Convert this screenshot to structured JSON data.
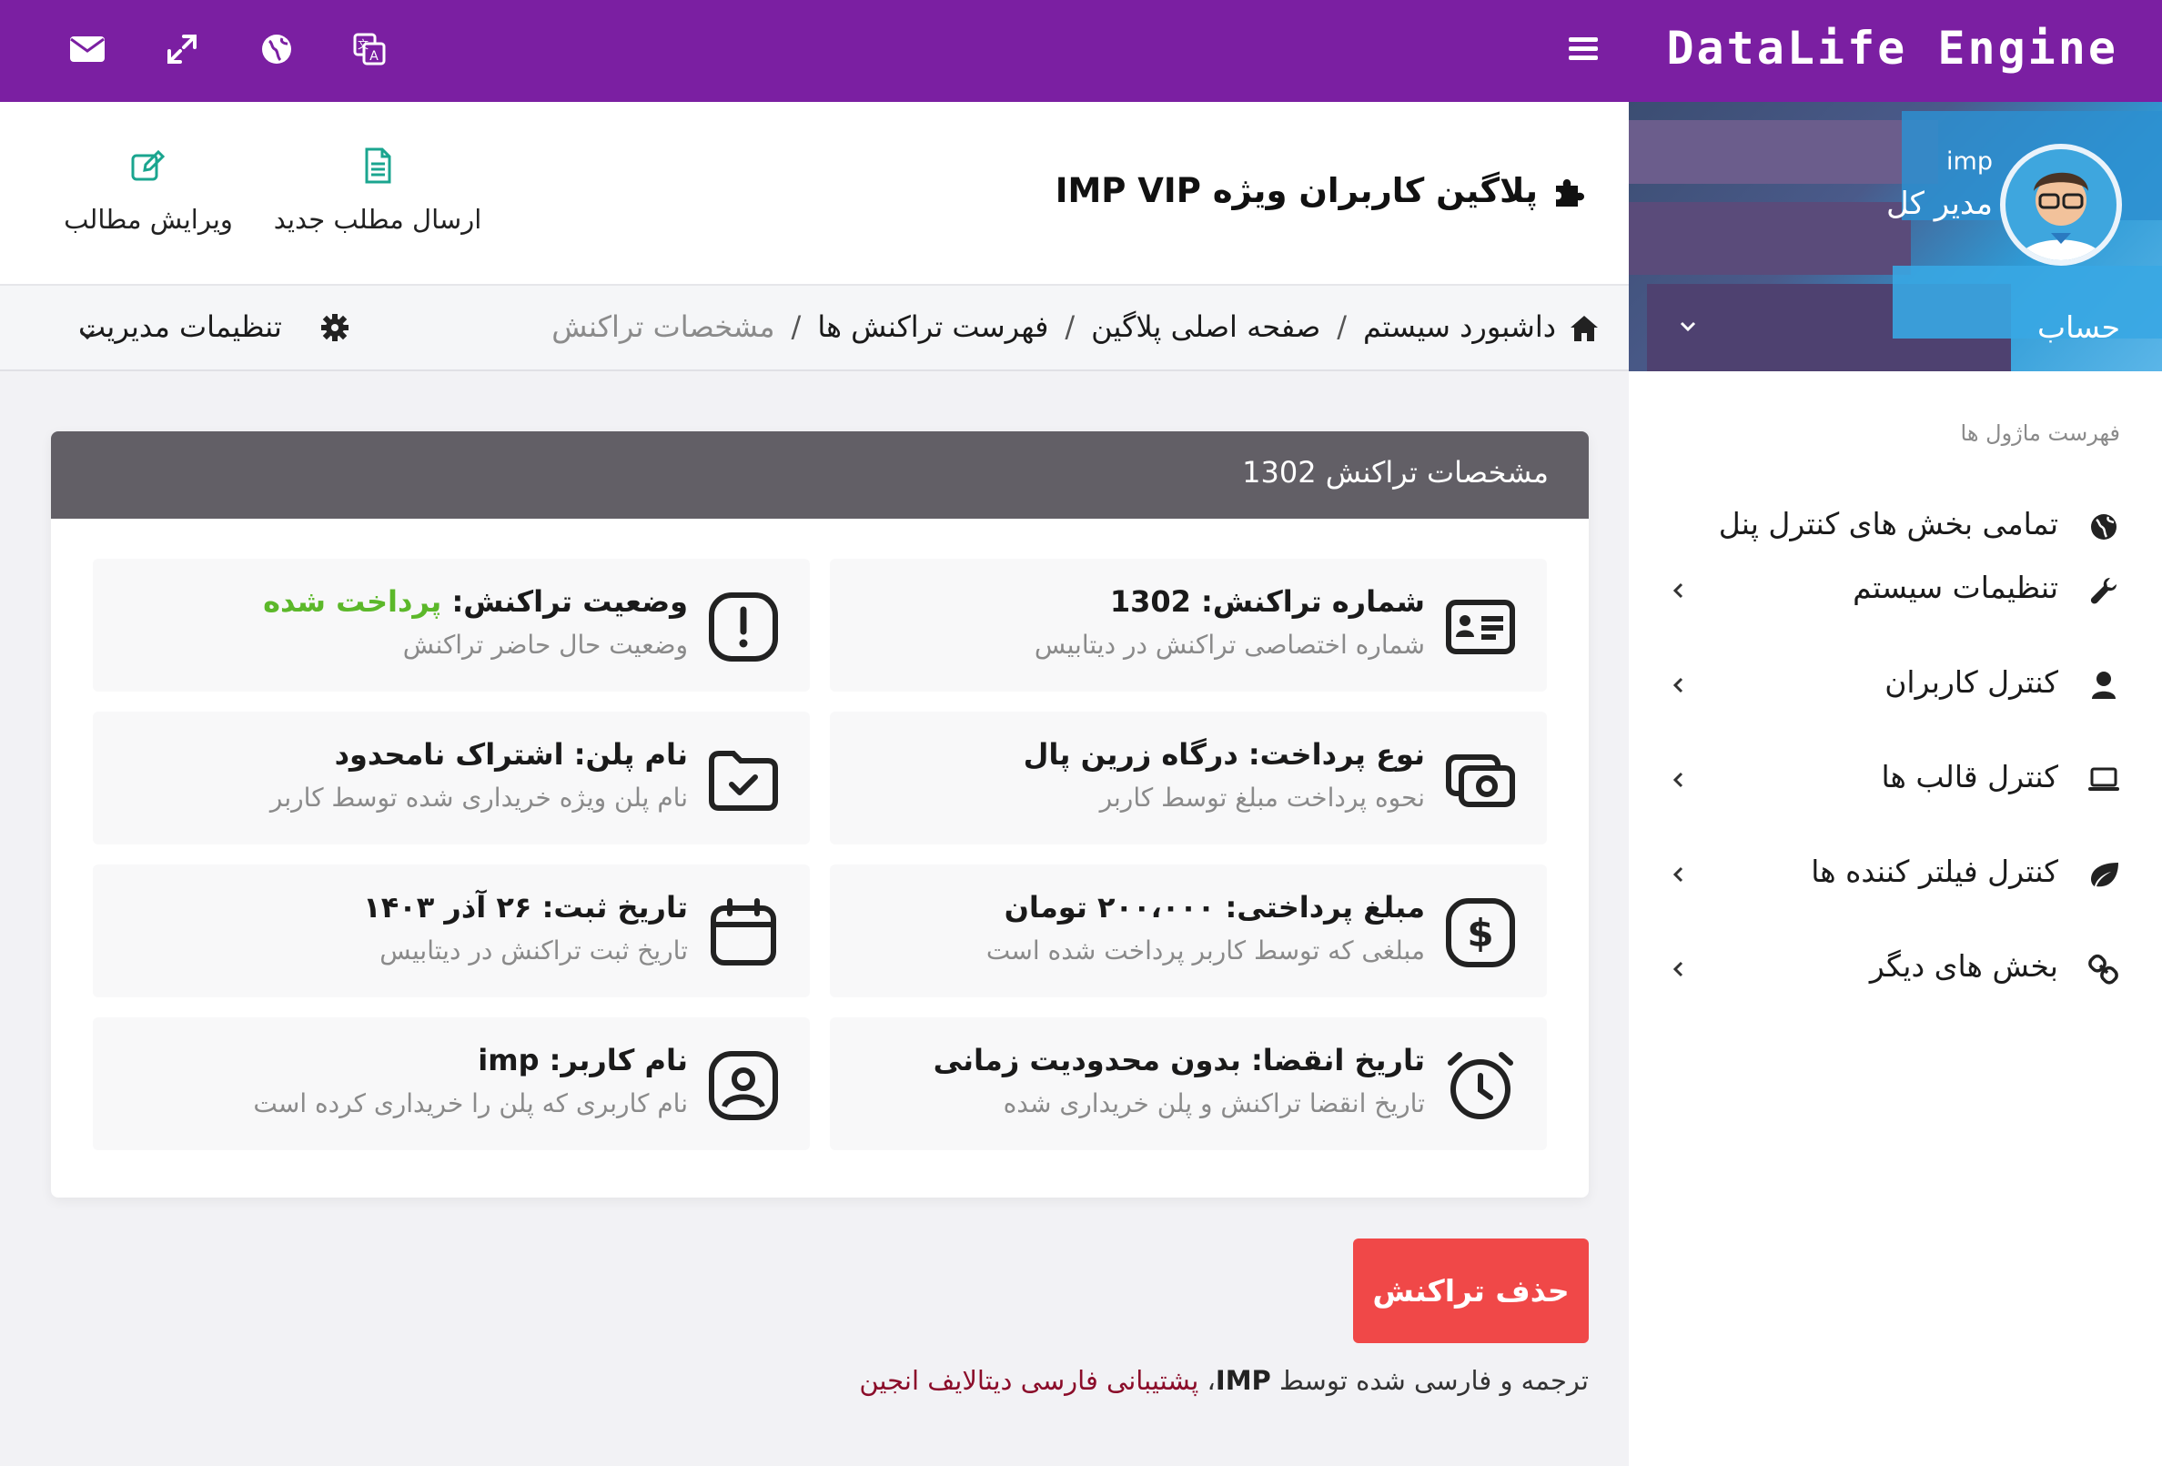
{
  "topbar": {
    "brand": "DataLife Engine",
    "icons": [
      "mail-icon",
      "expand-icon",
      "globe-icon",
      "translate-icon"
    ]
  },
  "sidebar": {
    "user": {
      "name": "imp",
      "role": "مدیر کل"
    },
    "account_label": "حساب",
    "modules_title": "فهرست ماژول ها",
    "items": [
      {
        "label": "تمامی بخش های کنترل پنل",
        "icon": "globe-icon"
      },
      {
        "label": "تنظیمات سیستم",
        "icon": "wrench-icon"
      },
      {
        "label": "کنترل کاربران",
        "icon": "user-icon"
      },
      {
        "label": "کنترل قالب ها",
        "icon": "laptop-icon"
      },
      {
        "label": "کنترل فیلتر کننده ها",
        "icon": "leaf-icon"
      },
      {
        "label": "بخش های دیگر",
        "icon": "link-icon"
      }
    ]
  },
  "header": {
    "title": "پلاگین کاربران ویژه IMP VIP",
    "quick": {
      "new_post": "ارسال مطلب جدید",
      "edit_posts": "ویرایش مطالب"
    }
  },
  "breadcrumb": {
    "items": [
      "داشبورد سیستم",
      "صفحه اصلی پلاگین",
      "فهرست تراکنش ها",
      "مشخصات تراکنش"
    ],
    "admin_settings": "تنظیمات مدیریت"
  },
  "panel": {
    "title": "مشخصات تراکنش 1302",
    "cells": {
      "number": {
        "title": "شماره تراکنش: 1302",
        "sub": "شماره اختصاصی تراکنش در دیتابیس"
      },
      "status": {
        "title_prefix": "وضعیت تراکنش: ",
        "title_value": "پرداخت شده",
        "sub": "وضعیت حال حاضر تراکنش"
      },
      "payment_type": {
        "title": "نوع پرداخت: درگاه زرین پال",
        "sub": "نحوه پرداخت مبلغ توسط کاربر"
      },
      "plan": {
        "title": "نام پلن: اشتراک نامحدود",
        "sub": "نام پلن ویژه خریداری شده توسط کاربر"
      },
      "amount": {
        "title": "مبلغ پرداختی: ۲۰۰،۰۰۰ تومان",
        "sub": "مبلغی که توسط کاربر پرداخت شده است"
      },
      "date": {
        "title": "تاریخ ثبت: ۲۶ آذر ۱۴۰۳",
        "sub": "تاریخ ثبت تراکنش در دیتابیس"
      },
      "expiry": {
        "title": "تاریخ انقضا: بدون محدودیت زمانی",
        "sub": "تاریخ انقضا تراکنش و پلن خریداری شده"
      },
      "username": {
        "title": "نام کاربر: imp",
        "sub": "نام کاربری که پلن را خریداری کرده است"
      }
    }
  },
  "actions": {
    "delete": "حذف تراکنش"
  },
  "footer": {
    "prefix": "ترجمه و فارسی شده توسط ",
    "brand": "IMP",
    "comma": "، ",
    "link": "پشتیبانی فارسی دیتالایف انجین"
  },
  "colors": {
    "accent": "#7b1fa2",
    "danger": "#f04848",
    "success": "#5cb82a"
  }
}
